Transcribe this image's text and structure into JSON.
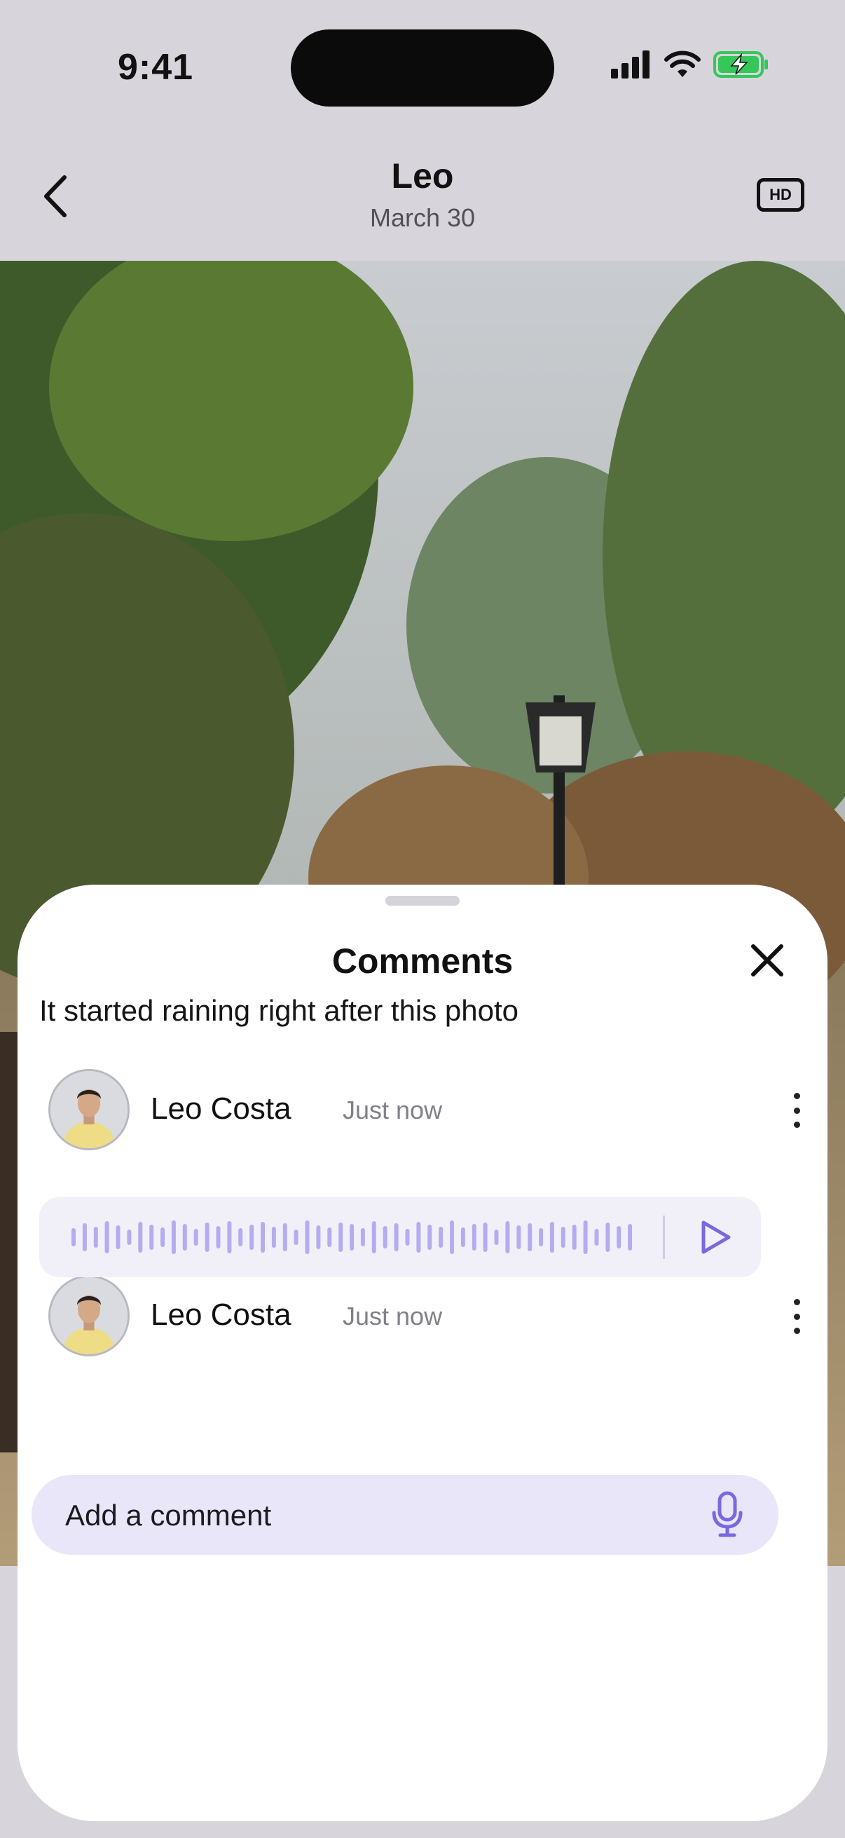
{
  "status_bar": {
    "time": "9:41",
    "icons": [
      "cellular-signal-icon",
      "wifi-icon",
      "battery-charging-icon"
    ]
  },
  "header": {
    "title": "Leo",
    "subtitle": "March 30",
    "hd_label": "HD",
    "icons": [
      "chevron-left-icon"
    ]
  },
  "sheet": {
    "title": "Comments",
    "comments": [
      {
        "author": "Leo Costa",
        "time": "Just now",
        "text": "It started raining right after this photo"
      },
      {
        "author": "Leo Costa",
        "time": "Just now",
        "type": "voice"
      }
    ],
    "input": {
      "placeholder": "Add a comment"
    }
  },
  "colors": {
    "accent": "#7a68e0",
    "waveform": "#b5acef",
    "input_bg": "#e8e6f8",
    "voice_bg": "#f1f0f9"
  }
}
